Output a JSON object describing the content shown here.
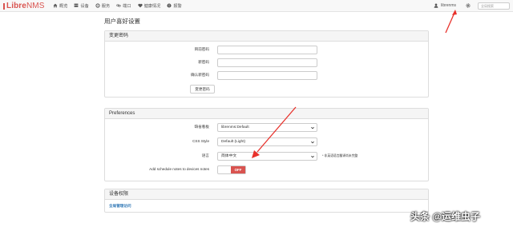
{
  "navbar": {
    "brand_libre": "Libre",
    "brand_nms": "NMS",
    "items": [
      {
        "label": "概览",
        "icon": "home-icon"
      },
      {
        "label": "设备",
        "icon": "server-icon"
      },
      {
        "label": "服务",
        "icon": "cog-icon"
      },
      {
        "label": "端口",
        "icon": "link-icon"
      },
      {
        "label": "健康情况",
        "icon": "heartbeat-icon"
      },
      {
        "label": "报警",
        "icon": "alert-icon"
      }
    ],
    "user": "librenms",
    "search_placeholder": "全局搜索"
  },
  "page_title": "用户喜好设置",
  "change_password": {
    "heading": "变更密码",
    "current_label": "目前密码",
    "new_label": "新密码",
    "confirm_label": "确认新密码",
    "submit_label": "变更密码"
  },
  "preferences": {
    "heading": "Preferences",
    "dashboard_label": "缺省看板",
    "dashboard_value": "librenms:Default",
    "css_label": "CSS Style",
    "css_value": "Default (Light)",
    "language_label": "语言",
    "language_value": "简体中文",
    "language_hint": "* 非英语语言翻译尚未完整",
    "schedule_label": "Add schedule notes to devices notes",
    "toggle_label": "OFF"
  },
  "device_permissions": {
    "heading": "设备权限",
    "link": "全局管理访问"
  },
  "watermark": "头条 @运维虫子",
  "colors": {
    "brand": "#d9534f",
    "toggle_off": "#d9534f",
    "link": "#337ab7",
    "arrow": "#e8322c"
  }
}
